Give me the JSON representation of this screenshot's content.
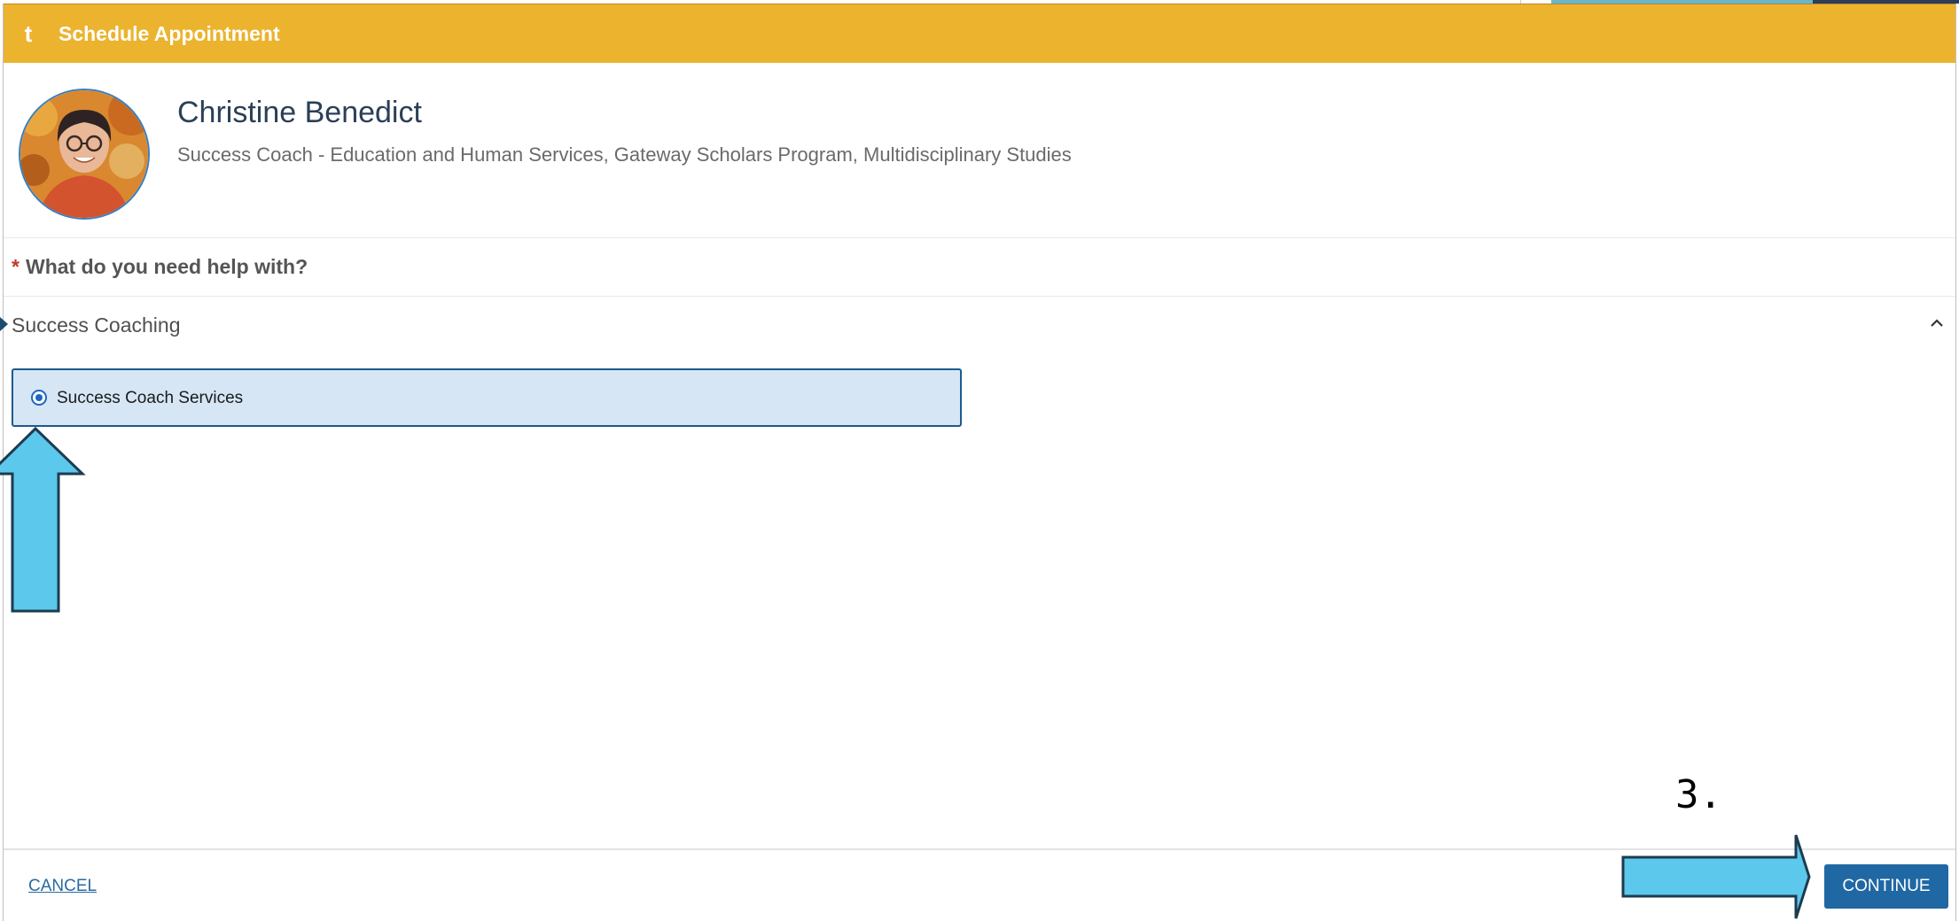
{
  "header": {
    "logo_glyph": "t",
    "title": "Schedule Appointment"
  },
  "profile": {
    "name": "Christine Benedict",
    "role": "Success Coach - Education and Human Services, Gateway Scholars Program, Multidisciplinary Studies"
  },
  "question": {
    "required_mark": "*",
    "text": "What do you need help with?"
  },
  "section": {
    "label": "Success Coaching",
    "expanded": true
  },
  "option": {
    "label": "Success Coach Services",
    "selected": true
  },
  "footer": {
    "cancel_label": "CANCEL",
    "continue_label": "CONTINUE"
  },
  "annotations": {
    "step_label": "3.",
    "arrow_color": "#5bc8ec",
    "arrow_stroke": "#1d3b4f"
  },
  "colors": {
    "header": "#ecb32f",
    "primary": "#2068a3",
    "option_bg": "#d6e6f5"
  }
}
